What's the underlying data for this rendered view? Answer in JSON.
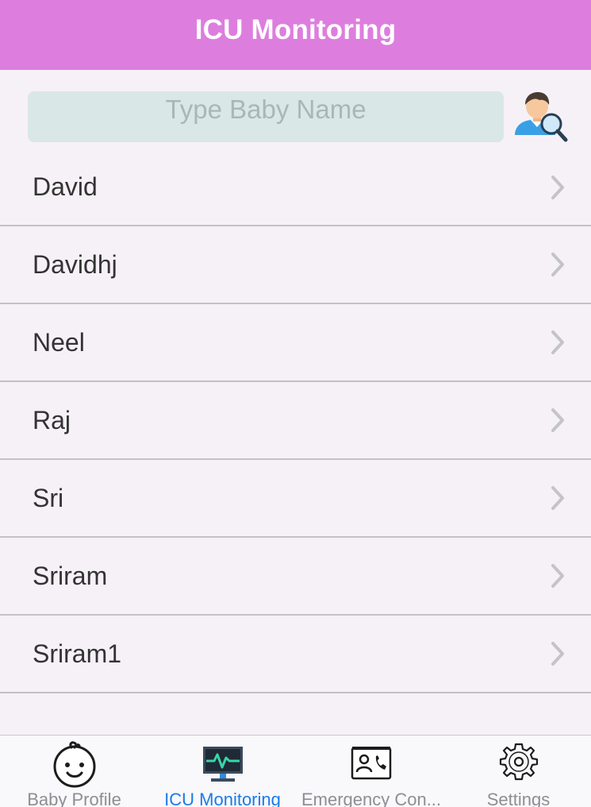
{
  "header": {
    "title": "ICU Monitoring"
  },
  "search": {
    "placeholder": "Type Baby Name",
    "value": "",
    "icon": "user-search-icon"
  },
  "babies": [
    {
      "name": "David"
    },
    {
      "name": "Davidhj"
    },
    {
      "name": "Neel"
    },
    {
      "name": "Raj"
    },
    {
      "name": "Sri"
    },
    {
      "name": "Sriram"
    },
    {
      "name": "Sriram1"
    }
  ],
  "tabs": [
    {
      "label": "Baby Profile",
      "icon": "baby-face-icon",
      "active": false
    },
    {
      "label": "ICU Monitoring",
      "icon": "monitor-heartbeat-icon",
      "active": true
    },
    {
      "label": "Emergency Con...",
      "icon": "contact-phone-icon",
      "active": false
    },
    {
      "label": "Settings",
      "icon": "gear-icon",
      "active": false
    }
  ],
  "colors": {
    "header_bg": "#dd7ede",
    "search_bg": "#d9e8e6",
    "active_tab": "#1a7ce8",
    "inactive_tab": "#8e8e93"
  }
}
